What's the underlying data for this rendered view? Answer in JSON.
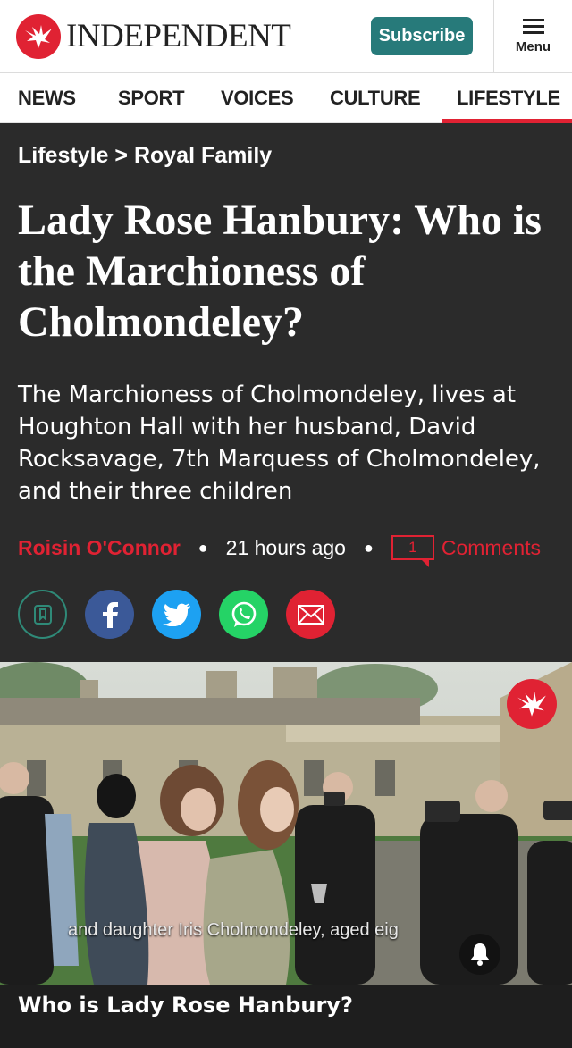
{
  "header": {
    "logo_text": "INDEPENDENT",
    "subscribe_label": "Subscribe",
    "menu_label": "Menu"
  },
  "nav": {
    "items": [
      {
        "label": "NEWS"
      },
      {
        "label": "SPORT"
      },
      {
        "label": "VOICES"
      },
      {
        "label": "CULTURE"
      },
      {
        "label": "LIFESTYLE",
        "active": true
      }
    ]
  },
  "article": {
    "breadcrumb": {
      "section": "Lifestyle",
      "separator": ">",
      "subsection": "Royal Family"
    },
    "title": "Lady Rose Hanbury: Who is the Marchioness of Cholmondeley?",
    "standfirst": "The Marchioness of Cholmondeley, lives at Houghton Hall with her husband, David Rocksavage, 7th Marquess of Cholmondeley, and their three children",
    "author": "Roisin O'Connor",
    "time": "21 hours ago",
    "comment_count": "1",
    "comments_label": "Comments",
    "share_buttons": [
      {
        "icon": "bookmark-icon",
        "color": "#2b2b2b"
      },
      {
        "icon": "facebook-icon",
        "color": "#3b5998"
      },
      {
        "icon": "twitter-icon",
        "color": "#1da1f2"
      },
      {
        "icon": "whatsapp-icon",
        "color": "#25d366"
      },
      {
        "icon": "email-icon",
        "color": "#e02233"
      }
    ],
    "hero_caption": "and daughter Iris Cholmondeley, aged eig",
    "subheading": "Who is Lady Rose Hanbury?"
  },
  "colors": {
    "brand_red": "#e02233",
    "subscribe_teal": "#277a7a",
    "background": "#2b2b2b"
  }
}
